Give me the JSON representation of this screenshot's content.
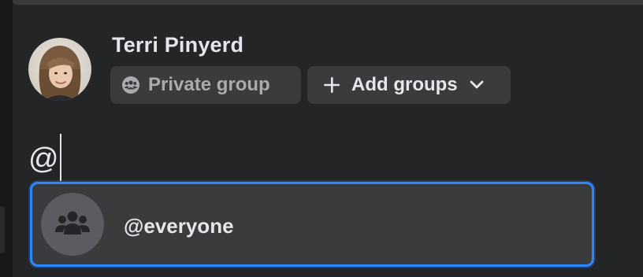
{
  "composer": {
    "author_name": "Terri Pinyerd",
    "privacy_label": "Private group",
    "add_groups_label": "Add groups",
    "text": "@"
  },
  "mention_suggestions": [
    {
      "label": "@everyone",
      "icon": "group-icon"
    }
  ],
  "icons": {
    "privacy": "group-icon",
    "add": "plus-icon",
    "dropdown": "chevron-down-icon"
  },
  "colors": {
    "background": "#242526",
    "chip": "#3a3b3c",
    "text_primary": "#e4e6eb",
    "text_secondary": "#a9abaf",
    "focus": "#2d88ff"
  }
}
